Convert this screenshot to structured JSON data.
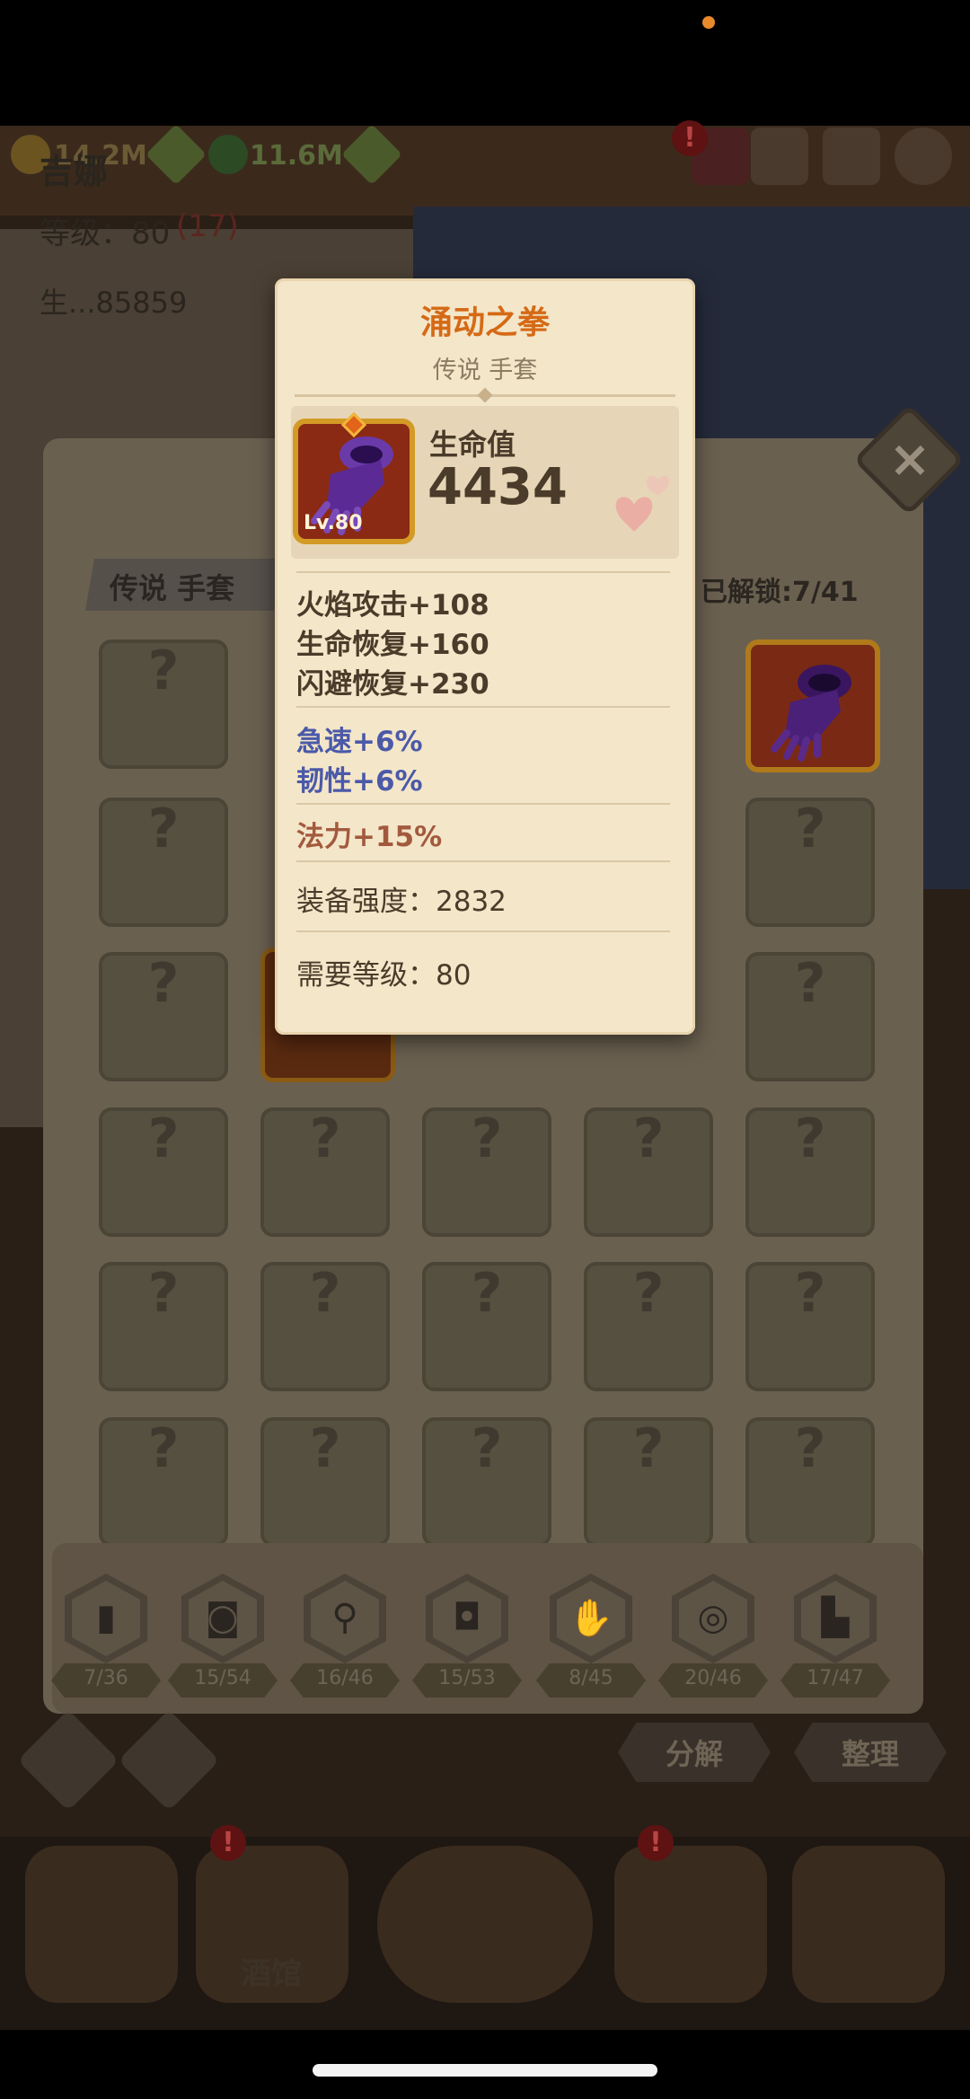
{
  "resources": [
    {
      "value": "14.2M",
      "color": "#6b5b35"
    },
    {
      "value": "11.6M",
      "color": "#5b6a3a"
    }
  ],
  "hero": {
    "name": "吉娜",
    "level_label": "等级：80",
    "level_extra": "(17)",
    "hp_label": "生...85859"
  },
  "collection": {
    "header": "传说 手套",
    "unlocked": "已解锁:7/41",
    "unknown_glyph": "?"
  },
  "slot_tabs": [
    {
      "name": "book",
      "glyph": "▮",
      "count": "7/36"
    },
    {
      "name": "armor-top",
      "glyph": "◙",
      "count": "15/54"
    },
    {
      "name": "amulet",
      "glyph": "⚲",
      "count": "16/46"
    },
    {
      "name": "robe",
      "glyph": "◘",
      "count": "15/53"
    },
    {
      "name": "glove",
      "glyph": "✋",
      "count": "8/45"
    },
    {
      "name": "ring",
      "glyph": "◎",
      "count": "20/46"
    },
    {
      "name": "boot",
      "glyph": "▙",
      "count": "17/47"
    }
  ],
  "actions": {
    "decompose": "分解",
    "organize": "整理"
  },
  "bottom_nav": {
    "tavern_label": "酒馆",
    "alert_glyph": "!"
  },
  "item_card": {
    "title": "涌动之拳",
    "subtitle": "传说 手套",
    "level_badge": "Lv.80",
    "main_stat_label": "生命值",
    "main_stat_value": "4434",
    "base_stats": [
      "火焰攻击+108",
      "生命恢复+160",
      "闪避恢复+230"
    ],
    "blue_stats": [
      "急速+6%",
      "韧性+6%"
    ],
    "special_stat": "法力+15%",
    "power": "装备强度：2832",
    "required_level": "需要等级：80",
    "colors": {
      "title": "#d56a16",
      "blue": "#4a59a8",
      "special": "#a25a3e",
      "normal": "#4a3b2a"
    }
  }
}
